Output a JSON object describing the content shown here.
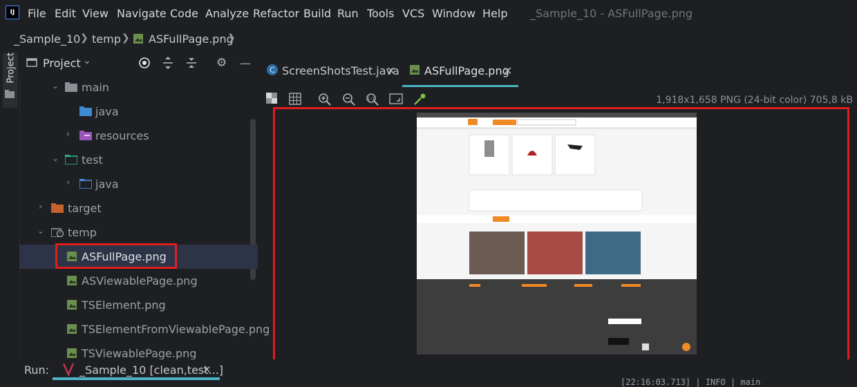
{
  "menubar": {
    "items": [
      "File",
      "Edit",
      "View",
      "Navigate",
      "Code",
      "Analyze",
      "Refactor",
      "Build",
      "Run",
      "Tools",
      "VCS",
      "Window",
      "Help"
    ],
    "window_title": "_Sample_10 - ASFullPage.png"
  },
  "breadcrumb": [
    "_Sample_10",
    "temp",
    "ASFullPage.png"
  ],
  "project_panel": {
    "side_label": "Project",
    "title": "Project",
    "tree": [
      {
        "label": "main",
        "type": "folder"
      },
      {
        "label": "java",
        "type": "source-folder"
      },
      {
        "label": "resources",
        "type": "resources-folder"
      },
      {
        "label": "test",
        "type": "test-folder"
      },
      {
        "label": "java",
        "type": "test-source-folder"
      },
      {
        "label": "target",
        "type": "excluded-folder"
      },
      {
        "label": "temp",
        "type": "temp-folder"
      },
      {
        "label": "ASFullPage.png",
        "type": "image",
        "selected": true
      },
      {
        "label": "ASViewablePage.png",
        "type": "image"
      },
      {
        "label": "TSElement.png",
        "type": "image"
      },
      {
        "label": "TSElementFromViewablePage.png",
        "type": "image"
      },
      {
        "label": "TSViewablePage.png",
        "type": "image"
      }
    ]
  },
  "editor": {
    "tabs": [
      {
        "label": "ScreenShotsTest.java",
        "active": false
      },
      {
        "label": "ASFullPage.png",
        "active": true
      }
    ],
    "image_info": "1,918x1,658 PNG (24-bit color) 705,8 kB"
  },
  "run_bar": {
    "label": "Run:",
    "tab_label": "_Sample_10 [clean,test...]",
    "log_line": "[22:16:03.713] | INFO  | main"
  },
  "colors": {
    "background": "#1e1f22",
    "selection": "#2d3447",
    "accent": "#4db3c6",
    "highlight_box": "#e01e1e",
    "dns_orange": "#f08a24"
  }
}
